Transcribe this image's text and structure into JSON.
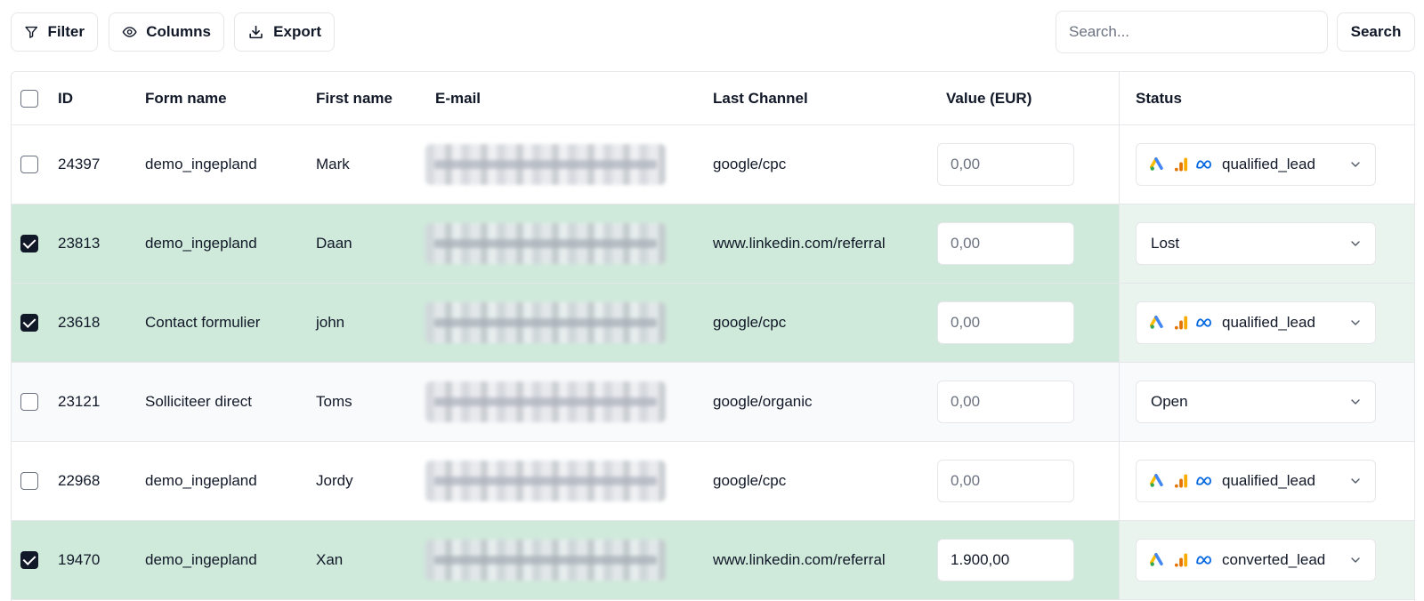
{
  "toolbar": {
    "filter_label": "Filter",
    "columns_label": "Columns",
    "export_label": "Export",
    "search_placeholder": "Search...",
    "search_label": "Search"
  },
  "table": {
    "headers": {
      "id": "ID",
      "form_name": "Form name",
      "first_name": "First name",
      "email": "E-mail",
      "last_channel": "Last Channel",
      "value": "Value (EUR)",
      "status": "Status"
    },
    "rows": [
      {
        "id": "24397",
        "form_name": "demo_ingepland",
        "first_name": "Mark",
        "last_channel": "google/cpc",
        "value": "",
        "value_placeholder": "0,00",
        "status": "qualified_lead",
        "status_icons": true,
        "checked": false,
        "state": "normal"
      },
      {
        "id": "23813",
        "form_name": "demo_ingepland",
        "first_name": "Daan",
        "last_channel": "www.linkedin.com/referral",
        "value": "",
        "value_placeholder": "0,00",
        "status": "Lost",
        "status_icons": false,
        "checked": true,
        "state": "selected"
      },
      {
        "id": "23618",
        "form_name": "Contact formulier",
        "first_name": "john",
        "last_channel": "google/cpc",
        "value": "",
        "value_placeholder": "0,00",
        "status": "qualified_lead",
        "status_icons": true,
        "checked": true,
        "state": "selected"
      },
      {
        "id": "23121",
        "form_name": "Solliciteer direct",
        "first_name": "Toms",
        "last_channel": "google/organic",
        "value": "",
        "value_placeholder": "0,00",
        "status": "Open",
        "status_icons": false,
        "checked": false,
        "state": "hover"
      },
      {
        "id": "22968",
        "form_name": "demo_ingepland",
        "first_name": "Jordy",
        "last_channel": "google/cpc",
        "value": "",
        "value_placeholder": "0,00",
        "status": "qualified_lead",
        "status_icons": true,
        "checked": false,
        "state": "normal"
      },
      {
        "id": "19470",
        "form_name": "demo_ingepland",
        "first_name": "Xan",
        "last_channel": "www.linkedin.com/referral",
        "value": "1.900,00",
        "value_placeholder": "0,00",
        "status": "converted_lead",
        "status_icons": true,
        "checked": true,
        "state": "selected"
      }
    ]
  },
  "colors": {
    "selected_row": "#cfe9db",
    "selected_status_cell": "#e8f4ed",
    "hover_row": "#f9fafb",
    "border": "#e5e7eb"
  },
  "icons": {
    "filter": "filter-icon",
    "columns": "eye-icon",
    "export": "download-icon",
    "google_ads": "google-ads-icon",
    "analytics": "google-analytics-icon",
    "meta": "meta-icon",
    "chevron": "chevron-down-icon"
  }
}
